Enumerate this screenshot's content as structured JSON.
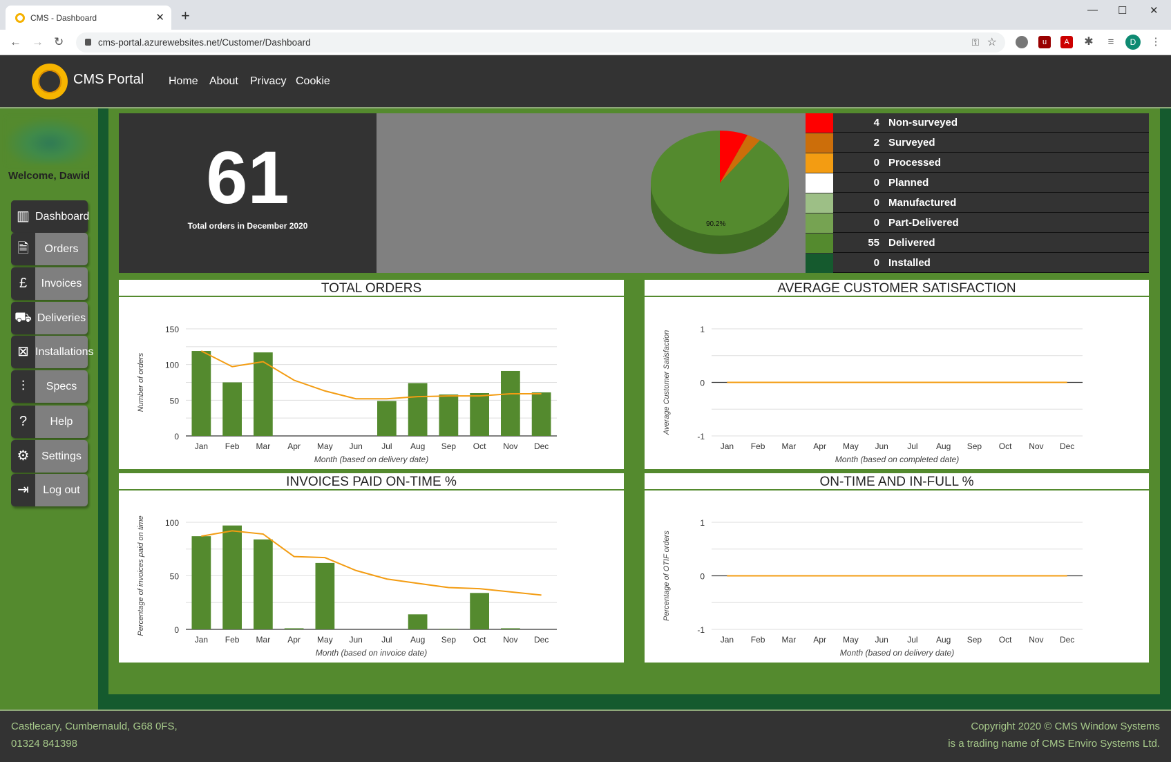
{
  "browser": {
    "tab_title": "CMS - Dashboard",
    "url": "cms-portal.azurewebsites.net/Customer/Dashboard",
    "profile_initial": "D"
  },
  "header": {
    "brand": "CMS Portal",
    "nav": [
      "Home",
      "About",
      "Privacy",
      "Cookie"
    ]
  },
  "sidebar": {
    "welcome": "Welcome, Dawid",
    "items": [
      {
        "label": "Dashboard",
        "icon": "bar-chart-icon",
        "active": true
      },
      {
        "label": "Orders",
        "icon": "document-arrow-icon"
      },
      {
        "label": "Invoices",
        "icon": "invoice-pound-icon"
      },
      {
        "label": "Deliveries",
        "icon": "truck-icon"
      },
      {
        "label": "Installations",
        "icon": "tools-icon"
      },
      {
        "label": "Specs",
        "icon": "sliders-icon"
      },
      {
        "label": "Help",
        "icon": "question-icon"
      },
      {
        "label": "Settings",
        "icon": "gears-icon"
      },
      {
        "label": "Log out",
        "icon": "logout-icon"
      }
    ]
  },
  "summary": {
    "total": "61",
    "caption": "Total orders in December 2020",
    "pie_label": "90.2%"
  },
  "status_legend": [
    {
      "count": 4,
      "label": "Non-surveyed",
      "color": "#ff0000"
    },
    {
      "count": 2,
      "label": "Surveyed",
      "color": "#cc6e0a"
    },
    {
      "count": 0,
      "label": "Processed",
      "color": "#f39c12"
    },
    {
      "count": 0,
      "label": "Planned",
      "color": "#ffffff"
    },
    {
      "count": 0,
      "label": "Manufactured",
      "color": "#9dbf86"
    },
    {
      "count": 0,
      "label": "Part-Delivered",
      "color": "#76a352"
    },
    {
      "count": 55,
      "label": "Delivered",
      "color": "#548a2e"
    },
    {
      "count": 0,
      "label": "Installed",
      "color": "#155a2e"
    }
  ],
  "chart_data": [
    {
      "type": "bar",
      "title": "TOTAL ORDERS",
      "xlabel": "Month (based on delivery date)",
      "ylabel": "Number of orders",
      "ylim": [
        0,
        150
      ],
      "yticks": [
        0,
        50,
        100,
        150
      ],
      "categories": [
        "Jan",
        "Feb",
        "Mar",
        "Apr",
        "May",
        "Jun",
        "Jul",
        "Aug",
        "Sep",
        "Oct",
        "Nov",
        "Dec"
      ],
      "values": [
        119,
        75,
        117,
        0,
        0,
        0,
        49,
        74,
        58,
        60,
        91,
        61
      ],
      "trend": [
        119,
        97,
        104,
        78,
        63,
        52,
        52,
        55,
        56,
        56,
        59,
        59
      ]
    },
    {
      "type": "line",
      "title": "AVERAGE CUSTOMER SATISFACTION",
      "xlabel": "Month (based on completed date)",
      "ylabel": "Average Customer Satisfaction",
      "ylim": [
        -1,
        1
      ],
      "yticks": [
        -1,
        0,
        1
      ],
      "categories": [
        "Jan",
        "Feb",
        "Mar",
        "Apr",
        "May",
        "Jun",
        "Jul",
        "Aug",
        "Sep",
        "Oct",
        "Nov",
        "Dec"
      ],
      "values": [],
      "trend": [
        0,
        0,
        0,
        0,
        0,
        0,
        0,
        0,
        0,
        0,
        0,
        0
      ]
    },
    {
      "type": "bar",
      "title": "INVOICES PAID ON-TIME %",
      "xlabel": "Month (based on invoice date)",
      "ylabel": "Percentage of invoices paid on time",
      "ylim": [
        0,
        100
      ],
      "yticks": [
        0,
        50,
        100
      ],
      "categories": [
        "Jan",
        "Feb",
        "Mar",
        "Apr",
        "May",
        "Jun",
        "Jul",
        "Aug",
        "Sep",
        "Oct",
        "Nov",
        "Dec"
      ],
      "values": [
        87,
        97,
        84,
        1,
        62,
        0,
        0,
        14,
        0.5,
        34,
        1,
        0
      ],
      "trend": [
        87,
        92,
        89,
        68,
        67,
        55,
        47,
        43,
        39,
        38,
        35,
        32
      ]
    },
    {
      "type": "line",
      "title": "ON-TIME AND IN-FULL %",
      "xlabel": "Month (based on delivery date)",
      "ylabel": "Percentage of OTIF orders",
      "ylim": [
        -1,
        1
      ],
      "yticks": [
        -1,
        0,
        1
      ],
      "categories": [
        "Jan",
        "Feb",
        "Mar",
        "Apr",
        "May",
        "Jun",
        "Jul",
        "Aug",
        "Sep",
        "Oct",
        "Nov",
        "Dec"
      ],
      "values": [],
      "trend": [
        0,
        0,
        0,
        0,
        0,
        0,
        0,
        0,
        0,
        0,
        0,
        0
      ]
    }
  ],
  "footer": {
    "address": "Castlecary, Cumbernauld, G68 0FS,",
    "phone": "01324 841398",
    "copyright": "Copyright 2020 © CMS Window Systems",
    "trading": "is a trading name of CMS Enviro Systems Ltd."
  },
  "colors": {
    "bar": "#548a2e",
    "trend": "#f39c12",
    "dark": "#333333"
  }
}
